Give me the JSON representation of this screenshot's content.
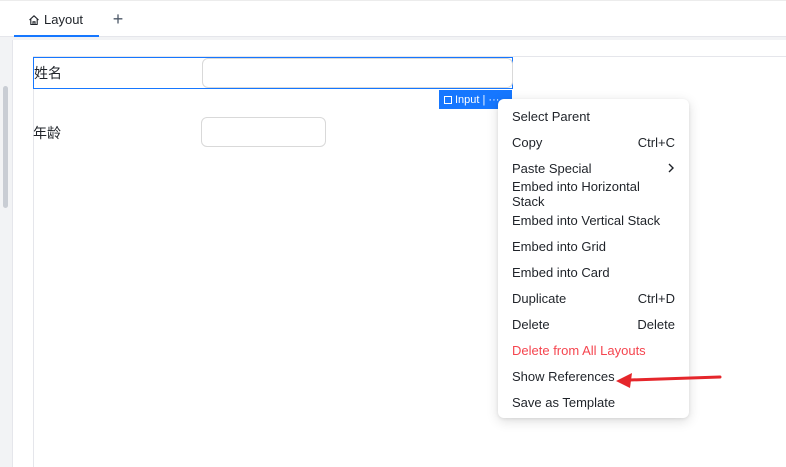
{
  "tabs": {
    "active_label": "Layout",
    "add_label": "+"
  },
  "form": {
    "row1": {
      "label": "姓名",
      "value": ""
    },
    "row2": {
      "label": "年龄",
      "value": ""
    }
  },
  "selection": {
    "tag_label": "Input | ···"
  },
  "context_menu": {
    "items": [
      {
        "label": "Select Parent",
        "shortcut": ""
      },
      {
        "label": "Copy",
        "shortcut": "Ctrl+C"
      },
      {
        "label": "Paste Special",
        "shortcut": "",
        "submenu_icon": "chevron-right-icon"
      },
      {
        "label": "Embed into Horizontal Stack",
        "shortcut": ""
      },
      {
        "label": "Embed into Vertical Stack",
        "shortcut": ""
      },
      {
        "label": "Embed into Grid",
        "shortcut": ""
      },
      {
        "label": "Embed into Card",
        "shortcut": ""
      },
      {
        "label": "Duplicate",
        "shortcut": "Ctrl+D"
      },
      {
        "label": "Delete",
        "shortcut": "Delete"
      },
      {
        "label": "Delete from All Layouts",
        "shortcut": "",
        "danger": true
      },
      {
        "label": "Show References",
        "shortcut": ""
      },
      {
        "label": "Save as Template",
        "shortcut": ""
      }
    ]
  },
  "colors": {
    "accent": "#1677ff",
    "danger": "#f5454f",
    "annotation_arrow": "#e5262b"
  },
  "icons": {
    "tab": "home-icon",
    "annotation": "red-arrow-icon"
  }
}
